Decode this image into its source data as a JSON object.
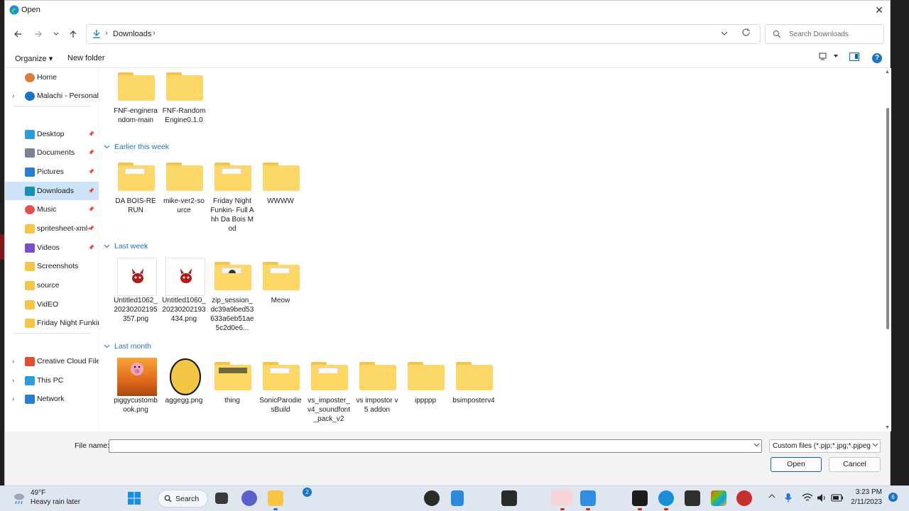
{
  "window": {
    "title": "Open",
    "close_glyph": "✕"
  },
  "address": {
    "crumb": "Downloads",
    "separator": "›"
  },
  "search": {
    "placeholder": "Search Downloads"
  },
  "toolbar": {
    "organize_label": "Organize ▾",
    "new_folder_label": "New folder",
    "help_label": "?"
  },
  "sidebar": {
    "items": [
      {
        "label": "Home",
        "icon": "home-icon",
        "chevron": false,
        "pinned": false
      },
      {
        "label": "Malachi - Personal",
        "icon": "onedrive-icon",
        "chevron": true,
        "pinned": false
      },
      {
        "label": "Desktop",
        "icon": "desktop-icon",
        "chevron": false,
        "pinned": true
      },
      {
        "label": "Documents",
        "icon": "documents-icon",
        "chevron": false,
        "pinned": true
      },
      {
        "label": "Pictures",
        "icon": "pictures-icon",
        "chevron": false,
        "pinned": true
      },
      {
        "label": "Downloads",
        "icon": "downloads-icon",
        "chevron": false,
        "pinned": true,
        "selected": true
      },
      {
        "label": "Music",
        "icon": "music-icon",
        "chevron": false,
        "pinned": true
      },
      {
        "label": "spritesheet-xml-",
        "icon": "folder-icon",
        "chevron": false,
        "pinned": true
      },
      {
        "label": "Videos",
        "icon": "videos-icon",
        "chevron": false,
        "pinned": true
      },
      {
        "label": "Screenshots",
        "icon": "folder-icon",
        "chevron": false,
        "pinned": false
      },
      {
        "label": "source",
        "icon": "folder-icon",
        "chevron": false,
        "pinned": false
      },
      {
        "label": "VidEO",
        "icon": "folder-icon",
        "chevron": false,
        "pinned": false
      },
      {
        "label": "Friday Night Funkin",
        "icon": "folder-icon",
        "chevron": false,
        "pinned": false
      },
      {
        "label": "Creative Cloud Files",
        "icon": "creative-cloud-icon",
        "chevron": true,
        "pinned": false
      },
      {
        "label": "This PC",
        "icon": "pc-icon",
        "chevron": true,
        "pinned": false
      },
      {
        "label": "Network",
        "icon": "network-icon",
        "chevron": true,
        "pinned": false
      }
    ]
  },
  "groups": {
    "earlier": "Earlier this week",
    "last_week": "Last week",
    "last_month": "Last month"
  },
  "files": {
    "top": [
      {
        "name": "FNF-enginerandom-main",
        "kind": "folder"
      },
      {
        "name": "FNF-RandomEngine0.1.0",
        "kind": "folder"
      }
    ],
    "earlier": [
      {
        "name": "DA BOIS-RERUN",
        "kind": "folder-paper"
      },
      {
        "name": "mike-ver2-source",
        "kind": "folder"
      },
      {
        "name": "Friday Night Funkin- Full Ahh Da Bois Mod",
        "kind": "folder-paper"
      },
      {
        "name": "WWWW",
        "kind": "folder"
      }
    ],
    "last_week": [
      {
        "name": "Untitled1062_20230202195357.png",
        "kind": "image-red"
      },
      {
        "name": "Untitled1060_20230202193434.png",
        "kind": "image-red"
      },
      {
        "name": "zip_session_dc39a9bed53633a6eb51ae5c2d0e6...",
        "kind": "folder-dark"
      },
      {
        "name": "Meow",
        "kind": "folder-paper"
      }
    ],
    "last_month": [
      {
        "name": "piggycustombook.png",
        "kind": "image-piggy"
      },
      {
        "name": "aggegg.png",
        "kind": "image-egg"
      },
      {
        "name": "thing",
        "kind": "folder-pic"
      },
      {
        "name": "SonicParodiesBuild",
        "kind": "folder-paper"
      },
      {
        "name": "vs_imposter_v4_soundfont_pack_v2",
        "kind": "folder-paper"
      },
      {
        "name": "vs impostor v5 addon",
        "kind": "folder"
      },
      {
        "name": "ippppp",
        "kind": "folder"
      },
      {
        "name": "bsimposterv4",
        "kind": "folder"
      }
    ]
  },
  "bottom": {
    "file_name_label": "File name:",
    "file_name_value": "",
    "filter_value": "Custom files (*.pjp;*.jpg;*.pjpeg",
    "open_label": "Open",
    "cancel_label": "Cancel"
  },
  "taskbar": {
    "weather_temp": "49°F",
    "weather_desc": "Heavy rain later",
    "search_label": "Search",
    "chat_badge": "2",
    "time": "3:23 PM",
    "date": "2/11/2023",
    "notifications": "6"
  },
  "colors": {
    "accent": "#0a5fb4",
    "folder": "#fcd86b",
    "selected": "#cde3f7",
    "group_header": "#2a6fb7"
  }
}
